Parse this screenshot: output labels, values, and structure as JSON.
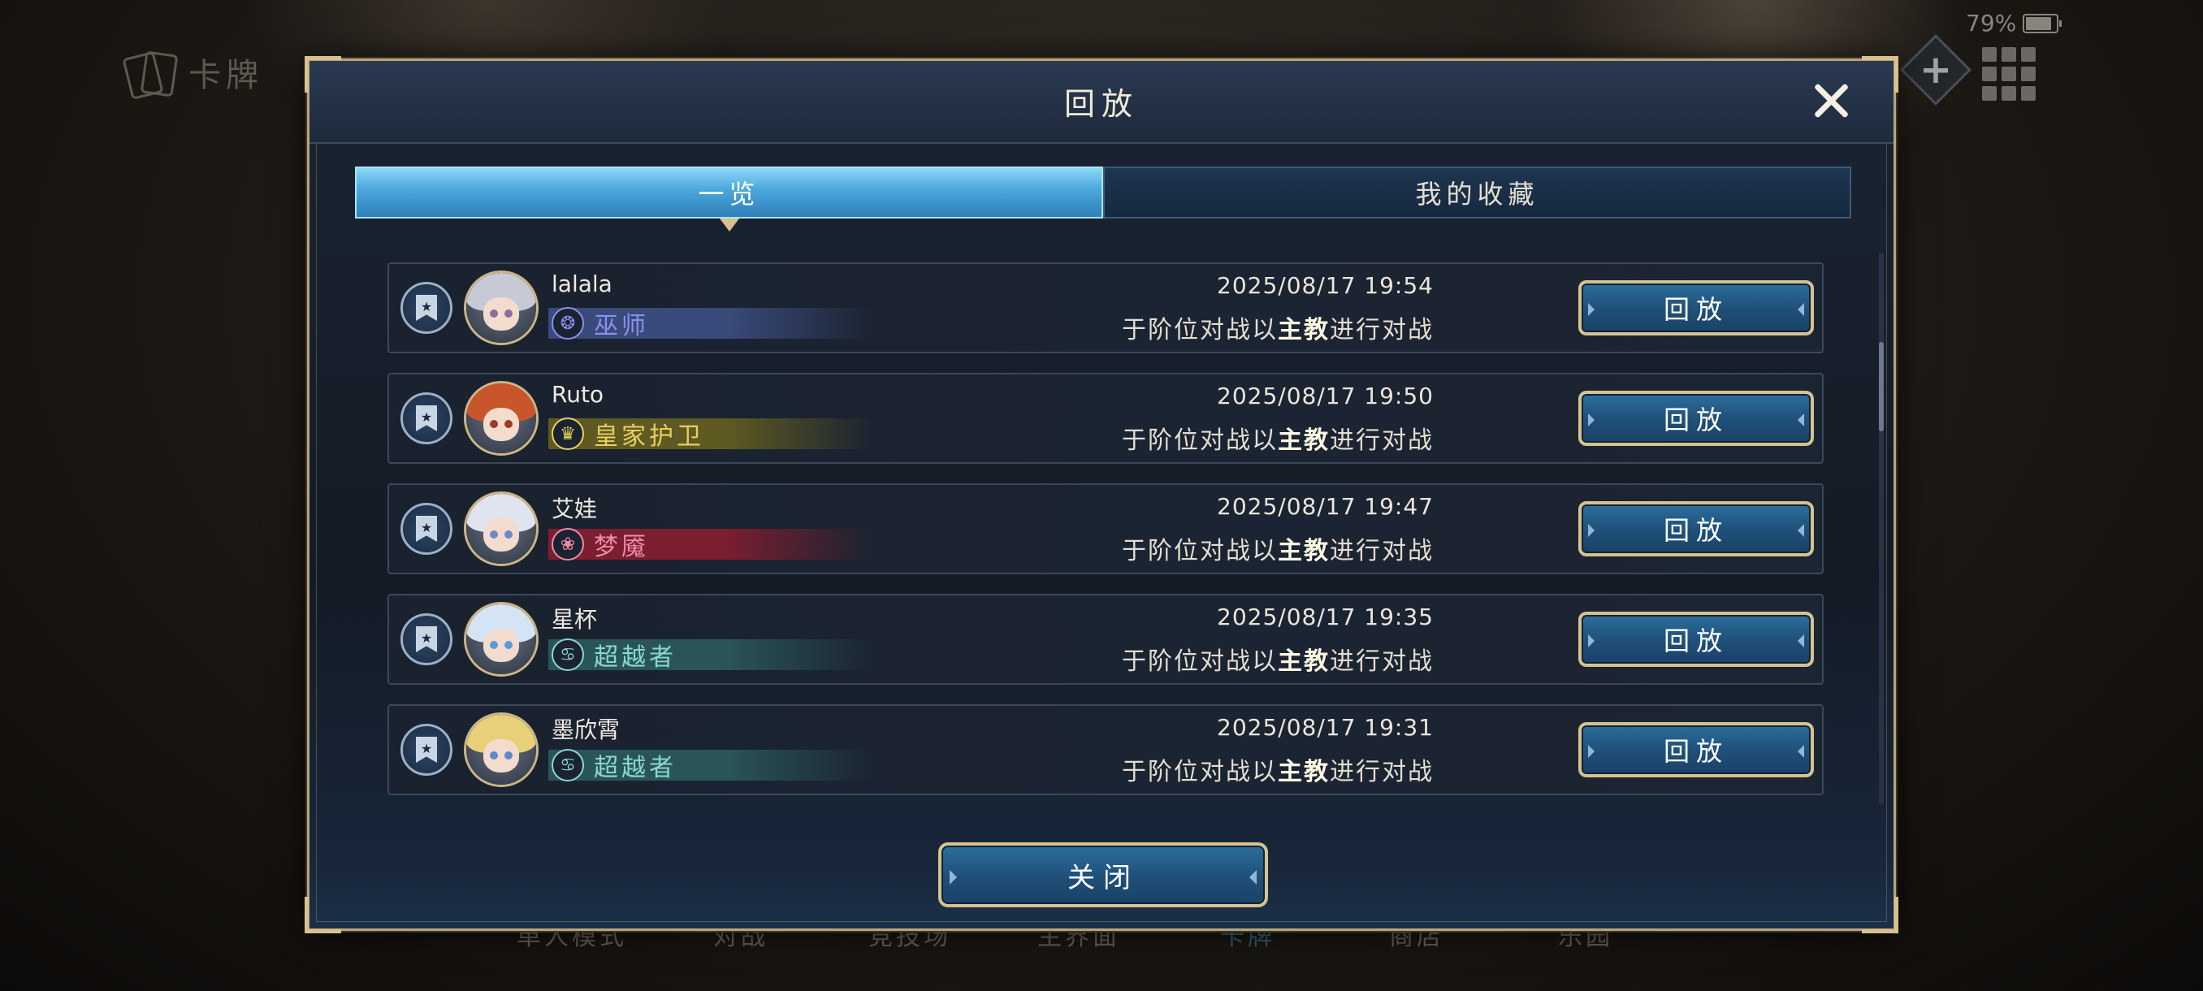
{
  "status": {
    "battery": "79%"
  },
  "background": {
    "screen_title": "卡牌",
    "nav": [
      "单人模式",
      "对战",
      "竞技场",
      "主界面",
      "卡牌",
      "商店",
      "乐园"
    ],
    "active_nav": "卡牌"
  },
  "modal": {
    "title": "回放",
    "tabs": [
      {
        "label": "一览",
        "active": true
      },
      {
        "label": "我的收藏",
        "active": false
      }
    ],
    "close_button": "关闭",
    "replays": [
      {
        "name": "lalala",
        "class": "巫师",
        "class_icon": "❂",
        "class_color": "#8a8ff0",
        "band_color": "#3a4a7a",
        "timestamp": "2025/08/17  19:54",
        "desc_prefix": "于阶位对战以",
        "desc_highlight": "主教",
        "desc_suffix": "进行对战",
        "button": "回放",
        "avatar_hair": "#c7c9d6",
        "avatar_eye": "#8a6f9a"
      },
      {
        "name": "Ruto",
        "class": "皇家护卫",
        "class_icon": "♛",
        "class_color": "#e8d060",
        "band_color": "#5f5a22",
        "timestamp": "2025/08/17  19:50",
        "desc_prefix": "于阶位对战以",
        "desc_highlight": "主教",
        "desc_suffix": "进行对战",
        "button": "回放",
        "avatar_hair": "#c8562a",
        "avatar_eye": "#9a3a2a"
      },
      {
        "name": "艾娃",
        "class": "梦魇",
        "class_icon": "❀",
        "class_color": "#f08aa8",
        "band_color": "#7a1e30",
        "timestamp": "2025/08/17  19:47",
        "desc_prefix": "于阶位对战以",
        "desc_highlight": "主教",
        "desc_suffix": "进行对战",
        "button": "回放",
        "avatar_hair": "#dfe4ef",
        "avatar_eye": "#6a8ac8"
      },
      {
        "name": "星杯",
        "class": "超越者",
        "class_icon": "♋",
        "class_color": "#8ad8d0",
        "band_color": "#2a5558",
        "timestamp": "2025/08/17  19:35",
        "desc_prefix": "于阶位对战以",
        "desc_highlight": "主教",
        "desc_suffix": "进行对战",
        "button": "回放",
        "avatar_hair": "#d4e4f4",
        "avatar_eye": "#5a9ad8"
      },
      {
        "name": "墨欣霄",
        "class": "超越者",
        "class_icon": "♋",
        "class_color": "#8ad8d0",
        "band_color": "#2a5558",
        "timestamp": "2025/08/17  19:31",
        "desc_prefix": "于阶位对战以",
        "desc_highlight": "主教",
        "desc_suffix": "进行对战",
        "button": "回放",
        "avatar_hair": "#e8d07a",
        "avatar_eye": "#5a8ac8"
      }
    ]
  }
}
